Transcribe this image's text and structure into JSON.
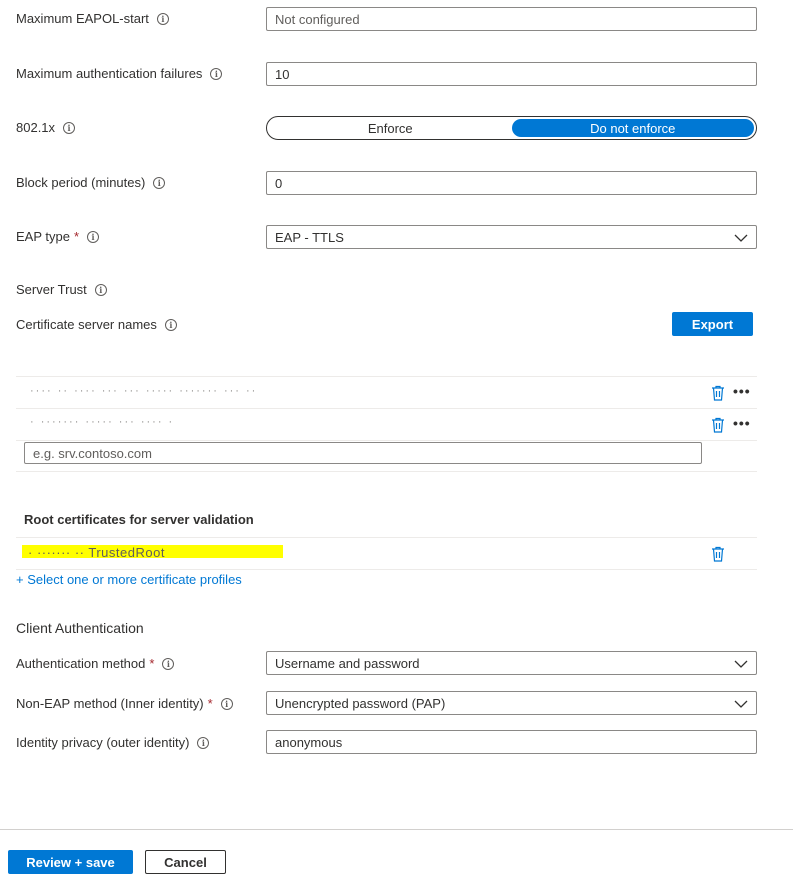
{
  "fields": {
    "max_eapol_start": {
      "label": "Maximum EAPOL-start",
      "placeholder": "Not configured"
    },
    "max_auth_failures": {
      "label": "Maximum authentication failures",
      "value": "10"
    },
    "dot1x": {
      "label": "802.1x",
      "options": [
        "Enforce",
        "Do not enforce"
      ],
      "selected": "Do not enforce"
    },
    "block_period": {
      "label": "Block period (minutes)",
      "value": "0"
    },
    "eap_type": {
      "label": "EAP type",
      "value": "EAP - TTLS"
    }
  },
  "server_trust": {
    "heading": "Server Trust",
    "cert_names_label": "Certificate server names",
    "export_label": "Export",
    "rows": [
      "···· ·· ···· ··· ··· ····· ······· ··· ··",
      "· ······· ····· ··· ···· ·"
    ],
    "new_placeholder": "e.g. srv.contoso.com",
    "root_heading": "Root certificates for server validation",
    "root_item": "· ······· ·· TrustedRoot",
    "select_link": "+ Select one or more certificate profiles"
  },
  "client_auth": {
    "heading": "Client Authentication",
    "auth_method": {
      "label": "Authentication method",
      "value": "Username and password"
    },
    "non_eap": {
      "label": "Non-EAP method (Inner identity)",
      "value": "Unencrypted password (PAP)"
    },
    "identity_privacy": {
      "label": "Identity privacy (outer identity)",
      "value": "anonymous"
    }
  },
  "footer": {
    "review_save": "Review + save",
    "cancel": "Cancel"
  },
  "colors": {
    "accent": "#0078d4",
    "required": "#a4262c",
    "highlight": "#ffff00"
  }
}
